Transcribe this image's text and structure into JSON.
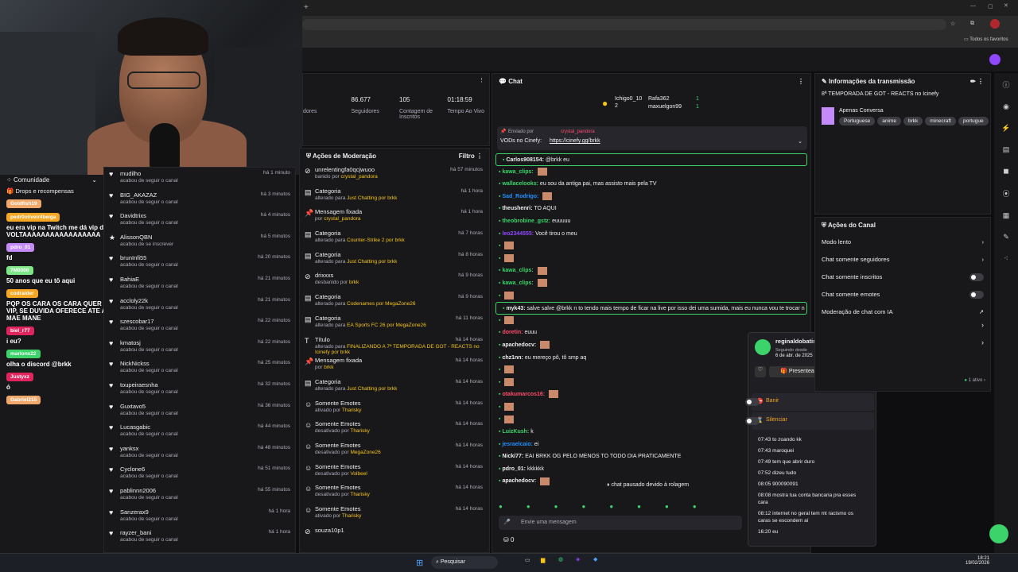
{
  "browser": {
    "bookmarks_label": "Todos os favoritos"
  },
  "sidebar_left": {
    "community": "Comunidade",
    "drops": "Drops e recompensas"
  },
  "stats": {
    "items": [
      {
        "value": "",
        "label": "dores"
      },
      {
        "value": "86.677",
        "label": "Seguidores"
      },
      {
        "value": "105",
        "label": "Contagem de Inscritos"
      },
      {
        "value": "01:18:59",
        "label": "Tempo Ao Vivo"
      }
    ]
  },
  "activity_feed": {
    "items": [
      {
        "name": "mudilho",
        "sub": "acabou de seguir o canal",
        "time": "há 1 minuto"
      },
      {
        "name": "BIG_AKAZAZ",
        "sub": "acabou de seguir o canal",
        "time": "há 3 minutos"
      },
      {
        "name": "Davidtrixs",
        "sub": "acabou de seguir o canal",
        "time": "há 4 minutos"
      },
      {
        "name": "AlissonQBN",
        "sub": "acabou de se inscrever",
        "time": "há 5 minutos"
      },
      {
        "name": "brunInfi55",
        "sub": "acabou de seguir o canal",
        "time": "há 20 minutos"
      },
      {
        "name": "BahiaE",
        "sub": "acabou de seguir o canal",
        "time": "há 21 minutos"
      },
      {
        "name": "accloly22k",
        "sub": "acabou de seguir o canal",
        "time": "há 21 minutos"
      },
      {
        "name": "szescobar17",
        "sub": "acabou de seguir o canal",
        "time": "há 22 minutos"
      },
      {
        "name": "kmatosj",
        "sub": "acabou de seguir o canal",
        "time": "há 22 minutos"
      },
      {
        "name": "NickNickss",
        "sub": "acabou de seguir o canal",
        "time": "há 25 minutos"
      },
      {
        "name": "toupeiraesnha",
        "sub": "acabou de seguir o canal",
        "time": "há 32 minutos"
      },
      {
        "name": "Guxtavo5",
        "sub": "acabou de seguir o canal",
        "time": "há 36 minutos"
      },
      {
        "name": "Lucasgabic",
        "sub": "acabou de seguir o canal",
        "time": "há 44 minutos"
      },
      {
        "name": "yanksx",
        "sub": "acabou de seguir o canal",
        "time": "há 48 minutos"
      },
      {
        "name": "Cyclone6",
        "sub": "acabou de seguir o canal",
        "time": "há 51 minutos"
      },
      {
        "name": "pablinnn2006",
        "sub": "acabou de seguir o canal",
        "time": "há 55 minutos"
      },
      {
        "name": "Sanzerax9",
        "sub": "acabou de seguir o canal",
        "time": "há 1 hora"
      },
      {
        "name": "rayzer_bani",
        "sub": "acabou de seguir o canal",
        "time": "há 1 hora"
      }
    ]
  },
  "mod_actions": {
    "title": "Ações de Moderação",
    "filter": "Filtro",
    "items": [
      {
        "name": "unrelentingfa0qcjwuoo",
        "sub": "banido por",
        "who": "crystal_pandora",
        "time": "há 57 minutos"
      },
      {
        "name": "Categoria",
        "sub": "alterado para",
        "who": "Just Chatting por brkk",
        "time": "há 1 hora"
      },
      {
        "name": "Mensagem fixada",
        "sub": "por",
        "who": "crystal_pandora",
        "time": "há 1 hora"
      },
      {
        "name": "Categoria",
        "sub": "alterado para",
        "who": "Counter-Strike 2 por brkk",
        "time": "há 7 horas"
      },
      {
        "name": "Categoria",
        "sub": "alterado para",
        "who": "Just Chatting por brkk",
        "time": "há 8 horas"
      },
      {
        "name": "drixxxs",
        "sub": "desbanido por",
        "who": "brkk",
        "time": "há 9 horas"
      },
      {
        "name": "Categoria",
        "sub": "alterado para",
        "who": "Codenames por MegaZone26",
        "time": "há 9 horas"
      },
      {
        "name": "Categoria",
        "sub": "alterado para",
        "who": "EA Sports FC 26 por MegaZone26",
        "time": "há 11 horas"
      },
      {
        "name": "Título",
        "sub": "alterado para",
        "who": "FINALIZANDO A 7ª TEMPORADA DE GOT - REACTS no Icinefy por brkk",
        "time": "há 14 horas"
      },
      {
        "name": "Mensagem fixada",
        "sub": "por",
        "who": "brkk",
        "time": "há 14 horas"
      },
      {
        "name": "Categoria",
        "sub": "alterado para",
        "who": "Just Chatting por brkk",
        "time": "há 14 horas"
      },
      {
        "name": "Somente Emotes",
        "sub": "ativado por",
        "who": "Tharisky",
        "time": "há 14 horas"
      },
      {
        "name": "Somente Emotes",
        "sub": "desativado por",
        "who": "Tharisky",
        "time": "há 14 horas"
      },
      {
        "name": "Somente Emotes",
        "sub": "desativado por",
        "who": "MegaZone26",
        "time": "há 14 horas"
      },
      {
        "name": "Somente Emotes",
        "sub": "desativado por",
        "who": "Volbeel",
        "time": "há 14 horas"
      },
      {
        "name": "Somente Emotes",
        "sub": "desativado por",
        "who": "Tharisky",
        "time": "há 14 horas"
      },
      {
        "name": "Somente Emotes",
        "sub": "ativado por",
        "who": "Tharisky",
        "time": "há 14 horas"
      },
      {
        "name": "souza10p1",
        "sub": "",
        "who": "",
        "time": ""
      }
    ]
  },
  "chat": {
    "title": "Chat",
    "leaders": [
      {
        "name": "Ichigo0_10",
        "count": "1"
      },
      {
        "name": "Rafa362",
        "count": "1"
      },
      {
        "name": "maxuelgon99",
        "count": "1"
      }
    ],
    "leader_count_2": "2",
    "pinned": {
      "sent_by": "Enviado por",
      "author": "crystal_pandora",
      "text": "VODs no Cinefy:",
      "link": "https://cinefy.gg/brkk"
    },
    "messages": [
      {
        "user": "Carlos908154:",
        "text": "@brkk eu",
        "color": "#efeff1",
        "highlight": true
      },
      {
        "user": "kawa_clips:",
        "text": "",
        "color": "#3cd36a"
      },
      {
        "user": "wallacelooks:",
        "text": "eu sou da antiga pai, mas assisto mais pela TV",
        "color": "#3cd36a"
      },
      {
        "user": "Sad_Rodrigo:",
        "text": "",
        "color": "#1e90ff"
      },
      {
        "user": "theushenri:",
        "text": "TO AQUI",
        "color": "#efeff1"
      },
      {
        "user": "theobrobine_gstz:",
        "text": "euuuuu",
        "color": "#3cd36a"
      },
      {
        "user": "leo2344555:",
        "text": "Você tirou o meu",
        "color": "#9147ff"
      },
      {
        "user": "",
        "text": "",
        "color": "#ff4d6d"
      },
      {
        "user": "",
        "text": "",
        "color": "#ff4d6d"
      },
      {
        "user": "kawa_clips:",
        "text": "",
        "color": "#3cd36a"
      },
      {
        "user": "kawa_clips:",
        "text": "",
        "color": "#3cd36a"
      },
      {
        "user": "",
        "text": "",
        "color": "#ff4d6d"
      },
      {
        "user": "myk43:",
        "text": "salve salve @brkk n to tendo mais tempo de ficar na live por isso dei uma sumida, mais eu nunca vou te trocar n bb",
        "color": "#efeff1",
        "highlight": true
      },
      {
        "user": "",
        "text": "",
        "color": "#ff4d6d"
      },
      {
        "user": "doretin:",
        "text": "euuu",
        "color": "#ff4d6d"
      },
      {
        "user": "apachedocv:",
        "text": "",
        "color": "#efeff1"
      },
      {
        "user": "chz1nn:",
        "text": "eu mereço pô, tô smp aq",
        "color": "#efeff1"
      },
      {
        "user": "",
        "text": "",
        "color": "#ff4d6d"
      },
      {
        "user": "",
        "text": "",
        "color": "#ff4d6d"
      },
      {
        "user": "otakumarcos16:",
        "text": "",
        "color": "#ff4d6d"
      },
      {
        "user": "",
        "text": "",
        "color": "#ff4d6d"
      },
      {
        "user": "",
        "text": "",
        "color": "#ff4d6d"
      },
      {
        "user": "LuizKush:",
        "text": "k",
        "color": "#3cd36a"
      },
      {
        "user": "jesraelcaio:",
        "text": "ei",
        "color": "#1e90ff"
      },
      {
        "user": "Nicki77:",
        "text": "EAI BRKK OG PELO MENOS TO TODO DIA PRATICAMENTE",
        "color": "#efeff1"
      },
      {
        "user": "pdro_01:",
        "text": "kkkkkk",
        "color": "#efeff1"
      },
      {
        "user": "apachedocv:",
        "text": "",
        "color": "#efeff1"
      }
    ],
    "paused": "chat pausado devido à rolagem",
    "input_placeholder": "Envie uma mensagem",
    "points": "0"
  },
  "user_card": {
    "name": "reginaldobatista",
    "since_label": "Seguindo desde",
    "since_date": "6 de abr. de 2025",
    "gift_btn": "Presentear com inscrição",
    "ban": "Banir",
    "timeout": "Silenciar",
    "history": [
      "07:43 to zoando kk",
      "07:43 maroquei",
      "07:49 tem que abrir duro",
      "07:52 dizeu tudo",
      "08:05 900090091",
      "08:08 mostra tua conta bancaria pra esses cara",
      "08:12 internet no geral tem mt racismo os caras se escondem aí",
      "16:20 eu",
      "16:20 eu?"
    ]
  },
  "stream_info": {
    "title": "Informações da transmissão",
    "stream_title": "8ª TEMPORADA DE GOT - REACTS no Icinefy",
    "category": "Apenas Conversa",
    "tags": [
      "Portuguese",
      "anime",
      "brkk",
      "minecraft",
      "portugue"
    ]
  },
  "channel_actions": {
    "title": "Ações do Canal",
    "items": [
      {
        "label": "Modo lento",
        "control": "arrow"
      },
      {
        "label": "Chat somente seguidores",
        "control": "arrow"
      },
      {
        "label": "Chat somente inscritos",
        "control": "toggle"
      },
      {
        "label": "Chat somente emotes",
        "control": "toggle"
      },
      {
        "label": "Moderação de chat com IA",
        "control": "ext"
      }
    ],
    "active": "1 ativo"
  },
  "left_chat": [
    {
      "badge": "Goldfish19",
      "color": "#f0a96b",
      "text": ""
    },
    {
      "badge": "pedr0oliveir4beiga",
      "color": "#f5a623",
      "text": "eu era vip na Twitch me dá vip de VOLTAAAAAAAAAAAAAAAAA"
    },
    {
      "badge": "pdro_01",
      "color": "#c58af9",
      "text": "fd"
    },
    {
      "badge": "7M0000",
      "color": "#7ee787",
      "text": "50 anos que eu tô aqui"
    },
    {
      "badge": "codraider",
      "color": "#f5a623",
      "text": "PQP OS CARA OS CARA QUER VIP, SE DUVIDA OFERECE ATE A MAE MANE"
    },
    {
      "badge": "biel_r77",
      "color": "#e0245e",
      "text": "i eu?"
    },
    {
      "badge": "marlonx22",
      "color": "#3cd36a",
      "text": "olha o discord @brkk"
    },
    {
      "badge": "Justyxz",
      "color": "#e0245e",
      "text": "ó"
    },
    {
      "badge": "Gabriel215",
      "color": "#f0a96b",
      "text": ""
    }
  ],
  "taskbar": {
    "search": "Pesquisar",
    "time": "18:21",
    "date": "19/02/2026"
  },
  "colors": {
    "accent": "#3cd36a",
    "bg": "#18181b"
  }
}
